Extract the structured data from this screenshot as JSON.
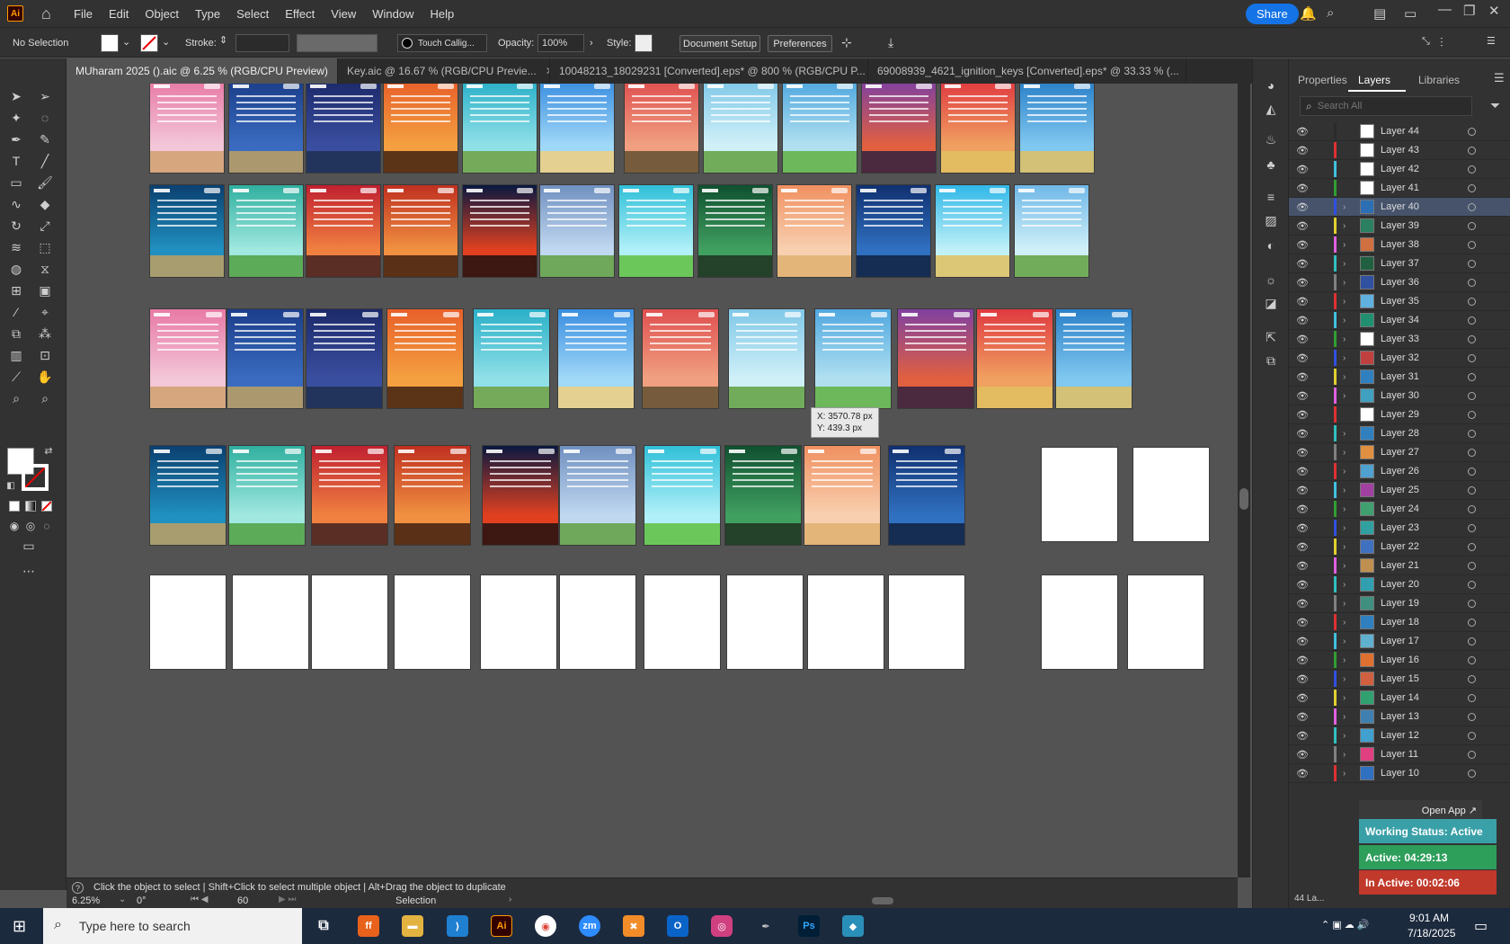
{
  "menubar": {
    "logo": "Ai",
    "items": [
      "File",
      "Edit",
      "Object",
      "Type",
      "Select",
      "Effect",
      "View",
      "Window",
      "Help"
    ],
    "share": "Share"
  },
  "control": {
    "selection": "No Selection",
    "stroke_label": "Stroke:",
    "brush": "Touch Callig...",
    "opacity_label": "Opacity:",
    "opacity": "100%",
    "style_label": "Style:",
    "doc_setup": "Document Setup",
    "preferences": "Preferences"
  },
  "tabs": [
    {
      "label": "MUharam 2025 ().aic @ 6.25 % (RGB/CPU Preview)",
      "active": true
    },
    {
      "label": "Key.aic @ 16.67 % (RGB/CPU Previe...",
      "active": false
    },
    {
      "label": "10048213_18029231 [Converted].eps* @ 800 % (RGB/CPU P...",
      "active": false
    },
    {
      "label": "69008939_4621_ignition_keys [Converted].eps* @ 33.33 % (...",
      "active": false
    }
  ],
  "tooltip": {
    "x": "X: 3570.78 px",
    "y": "Y: 439.3 px"
  },
  "status": {
    "hint": "Click the object to select  |  Shift+Click to select multiple object  |  Alt+Drag the object to duplicate",
    "zoom": "6.25%",
    "rotation": "0°",
    "artboard": "60",
    "tool": "Selection"
  },
  "panel": {
    "tabs": [
      "Properties",
      "Layers",
      "Libraries"
    ],
    "active_tab": "Layers",
    "search_placeholder": "Search All",
    "layer_count": "44 La...",
    "open_app": "Open App ↗",
    "layers": [
      {
        "name": "Layer 44",
        "color": "#2a2a2a",
        "thumb": "#ffffff",
        "expand": false
      },
      {
        "name": "Layer 43",
        "color": "#e03030",
        "thumb": "#ffffff",
        "expand": false
      },
      {
        "name": "Layer 42",
        "color": "#40c0e0",
        "thumb": "#ffffff",
        "expand": false
      },
      {
        "name": "Layer 41",
        "color": "#30a030",
        "thumb": "#ffffff",
        "expand": false
      },
      {
        "name": "Layer 40",
        "color": "#3050e0",
        "thumb": "#2c6fb5",
        "expand": true,
        "selected": true
      },
      {
        "name": "Layer 39",
        "color": "#e0d030",
        "thumb": "#2a8060",
        "expand": true
      },
      {
        "name": "Layer 38",
        "color": "#e060e0",
        "thumb": "#d07040",
        "expand": true
      },
      {
        "name": "Layer 37",
        "color": "#30c0c0",
        "thumb": "#206040",
        "expand": true
      },
      {
        "name": "Layer 36",
        "color": "#808080",
        "thumb": "#3050a0",
        "expand": true
      },
      {
        "name": "Layer 35",
        "color": "#e03030",
        "thumb": "#60b0e0",
        "expand": true
      },
      {
        "name": "Layer 34",
        "color": "#40c0e0",
        "thumb": "#209070",
        "expand": true
      },
      {
        "name": "Layer 33",
        "color": "#30a030",
        "thumb": "#ffffff",
        "expand": true
      },
      {
        "name": "Layer 32",
        "color": "#3050e0",
        "thumb": "#c04040",
        "expand": true
      },
      {
        "name": "Layer 31",
        "color": "#e0d030",
        "thumb": "#3080c0",
        "expand": true
      },
      {
        "name": "Layer 30",
        "color": "#e060e0",
        "thumb": "#40a0c0",
        "expand": true
      },
      {
        "name": "Layer 29",
        "color": "#e03030",
        "thumb": "#ffffff",
        "expand": false
      },
      {
        "name": "Layer 28",
        "color": "#30c0c0",
        "thumb": "#3080c0",
        "expand": true
      },
      {
        "name": "Layer 27",
        "color": "#808080",
        "thumb": "#e09040",
        "expand": true
      },
      {
        "name": "Layer 26",
        "color": "#e03030",
        "thumb": "#50a0d0",
        "expand": true
      },
      {
        "name": "Layer 25",
        "color": "#40c0e0",
        "thumb": "#a040a0",
        "expand": true
      },
      {
        "name": "Layer 24",
        "color": "#30a030",
        "thumb": "#40a070",
        "expand": true
      },
      {
        "name": "Layer 23",
        "color": "#3050e0",
        "thumb": "#30a0a0",
        "expand": true
      },
      {
        "name": "Layer 22",
        "color": "#e0d030",
        "thumb": "#4070c0",
        "expand": true
      },
      {
        "name": "Layer 21",
        "color": "#e060e0",
        "thumb": "#c09050",
        "expand": true
      },
      {
        "name": "Layer 20",
        "color": "#30c0c0",
        "thumb": "#30a0b0",
        "expand": true
      },
      {
        "name": "Layer 19",
        "color": "#808080",
        "thumb": "#409080",
        "expand": true
      },
      {
        "name": "Layer 18",
        "color": "#e03030",
        "thumb": "#3080c0",
        "expand": true
      },
      {
        "name": "Layer 17",
        "color": "#40c0e0",
        "thumb": "#60b0d0",
        "expand": true
      },
      {
        "name": "Layer 16",
        "color": "#30a030",
        "thumb": "#e07030",
        "expand": true
      },
      {
        "name": "Layer 15",
        "color": "#3050e0",
        "thumb": "#d06040",
        "expand": true
      },
      {
        "name": "Layer 14",
        "color": "#e0d030",
        "thumb": "#30a070",
        "expand": true
      },
      {
        "name": "Layer 13",
        "color": "#e060e0",
        "thumb": "#4080b0",
        "expand": true
      },
      {
        "name": "Layer 12",
        "color": "#30c0c0",
        "thumb": "#40a0d0",
        "expand": true
      },
      {
        "name": "Layer 11",
        "color": "#808080",
        "thumb": "#e04080",
        "expand": true
      },
      {
        "name": "Layer 10",
        "color": "#e03030",
        "thumb": "#3070c0",
        "expand": true
      }
    ]
  },
  "work_status": {
    "status": "Working Status: Active",
    "active": "Active: 04:29:13",
    "inactive": "In Active: 00:02:06"
  },
  "taskbar": {
    "search": "Type here to search",
    "time": "9:01 AM",
    "date": "7/18/2025"
  },
  "colors": {
    "accent": "#1473e6",
    "selected_layer": "#46536b",
    "status_active": "#2e9e5b",
    "status_inactive": "#c0392b",
    "status_working": "#3aa0a8"
  }
}
